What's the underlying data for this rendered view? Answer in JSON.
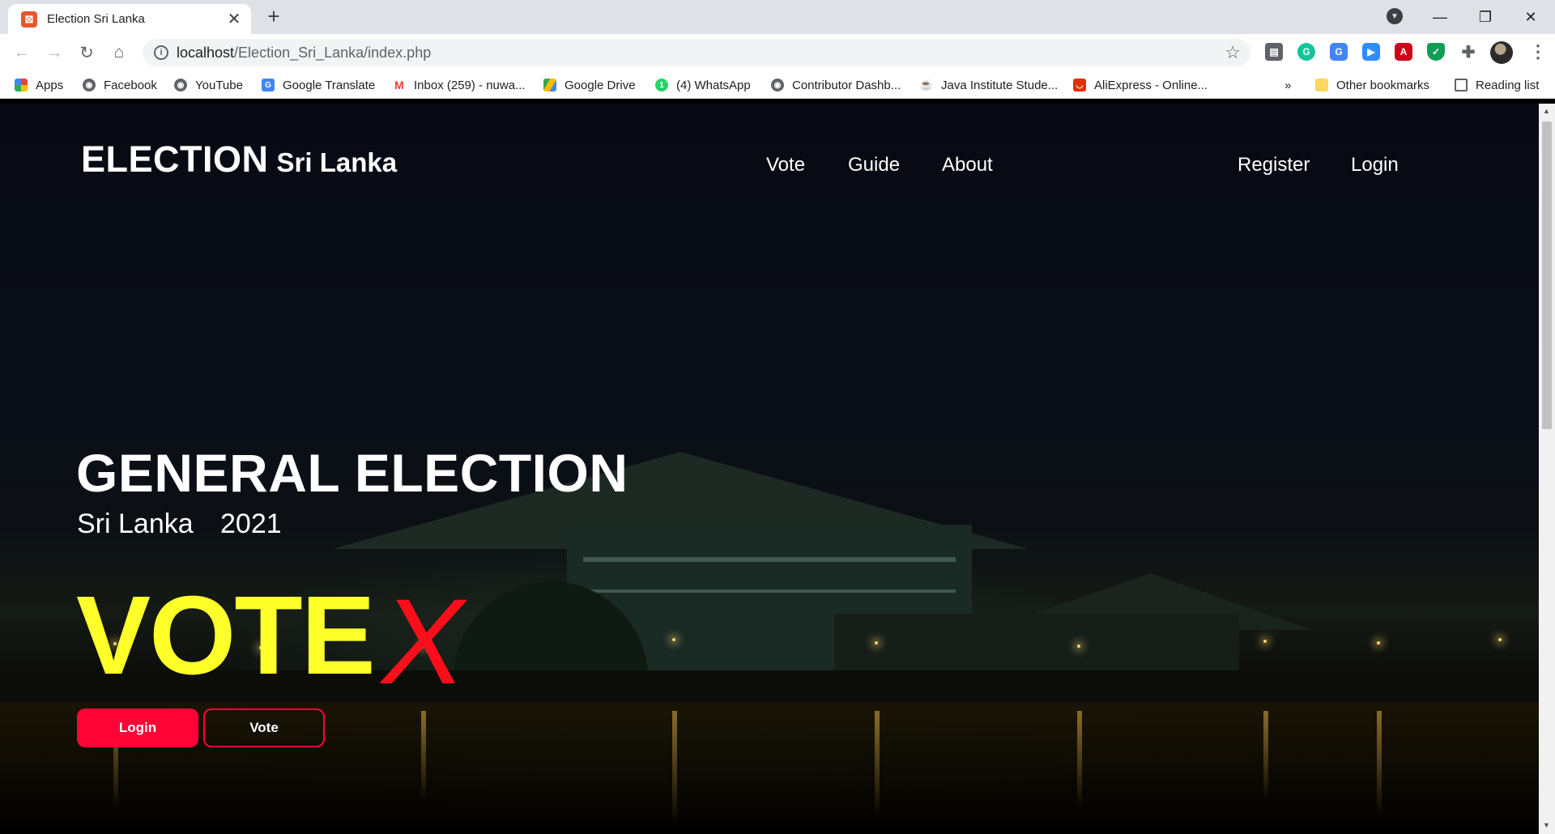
{
  "browser": {
    "tab_title": "Election Sri Lanka",
    "tab_close": "✕",
    "new_tab": "+",
    "url_host": "localhost",
    "url_path": "/Election_Sri_Lanka/index.php",
    "window_controls": {
      "minimize": "—",
      "maximize": "❐",
      "close": "✕"
    }
  },
  "bookmarks": [
    {
      "label": "Apps",
      "icon": "apps-grid-icon",
      "color": "#ea4335"
    },
    {
      "label": "Facebook",
      "icon": "globe-icon",
      "color": "#5f6368"
    },
    {
      "label": "YouTube",
      "icon": "globe-icon",
      "color": "#5f6368"
    },
    {
      "label": "Google Translate",
      "icon": "translate-icon",
      "color": "#4285f4"
    },
    {
      "label": "Inbox (259) - nuwa...",
      "icon": "gmail-icon",
      "color": "#ea4335"
    },
    {
      "label": "Google Drive",
      "icon": "drive-icon",
      "color": "#34a853"
    },
    {
      "label": "(4) WhatsApp",
      "icon": "whatsapp-icon",
      "color": "#25d366"
    },
    {
      "label": "Contributor Dashb...",
      "icon": "globe-icon",
      "color": "#5f6368"
    },
    {
      "label": "Java Institute Stude...",
      "icon": "java-icon",
      "color": "#c0392b"
    },
    {
      "label": "AliExpress - Online...",
      "icon": "aliexpress-icon",
      "color": "#e62e04"
    }
  ],
  "bookmarks_more": "»",
  "bookmarks_other": "Other bookmarks",
  "reading_list": "Reading list",
  "site": {
    "brand_main": "ELECTION",
    "brand_sub": "Sri Lanka",
    "nav": {
      "vote": "Vote",
      "guide": "Guide",
      "about": "About",
      "register": "Register",
      "login": "Login"
    },
    "hero": {
      "title": "GENERAL ELECTION",
      "country": "Sri Lanka",
      "year": "2021",
      "vote_word": "VOTE",
      "vote_mark": "X",
      "login_button": "Login",
      "vote_button": "Vote"
    },
    "colors": {
      "accent": "#ff0337",
      "vote_yellow": "#ffff2a",
      "vote_red": "#ff0d1b"
    }
  }
}
